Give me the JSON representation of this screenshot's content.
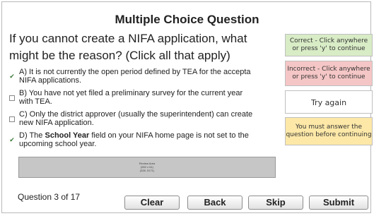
{
  "quiz": {
    "title": "Multiple Choice Question",
    "question": "If you cannot create a NIFA application, what might be the reason? (Click all that apply)",
    "options": [
      {
        "label_line1": "A) It is not currently the open period defined by TEA for the accepta",
        "label_line2": "NIFA applications.",
        "checked": true
      },
      {
        "label_line1": "B) You have not yet filed a preliminary survey for the current year",
        "label_line2": "with TEA.",
        "checked": false
      },
      {
        "label_line1": "C) Only the district approver (usually the superintendent) can create",
        "label_line2": "new NIFA application.",
        "checked": false
      },
      {
        "label_pre": "D) The ",
        "label_bold": "School Year",
        "label_post": " field on your NIFA home page is not set to the",
        "label_line2": "upcoming school year.",
        "checked": true
      }
    ],
    "review_area": {
      "line1": "Review Area",
      "line2": "(692 x 61)",
      "line3": "(328, 5171)"
    },
    "counter": "Question 3 of 17"
  },
  "buttons": {
    "clear": "Clear",
    "back": "Back",
    "skip": "Skip",
    "submit": "Submit"
  },
  "feedback": {
    "correct": "Correct - Click anywhere or press 'y' to continue",
    "incorrect": "Incorrect - Click anywhere or press 'y' to continue",
    "try_again": "Try again",
    "must_answer": "You must answer the question before continuing"
  },
  "colors": {
    "correct_bg": "#d8ecc6",
    "incorrect_bg": "#f5c6c6",
    "try_again_bg": "#ffffff",
    "must_answer_bg": "#fde8a8",
    "check": "#3a7a3a"
  },
  "icons": {
    "checked": "check-mark-icon",
    "unchecked": "empty-checkbox-icon"
  }
}
